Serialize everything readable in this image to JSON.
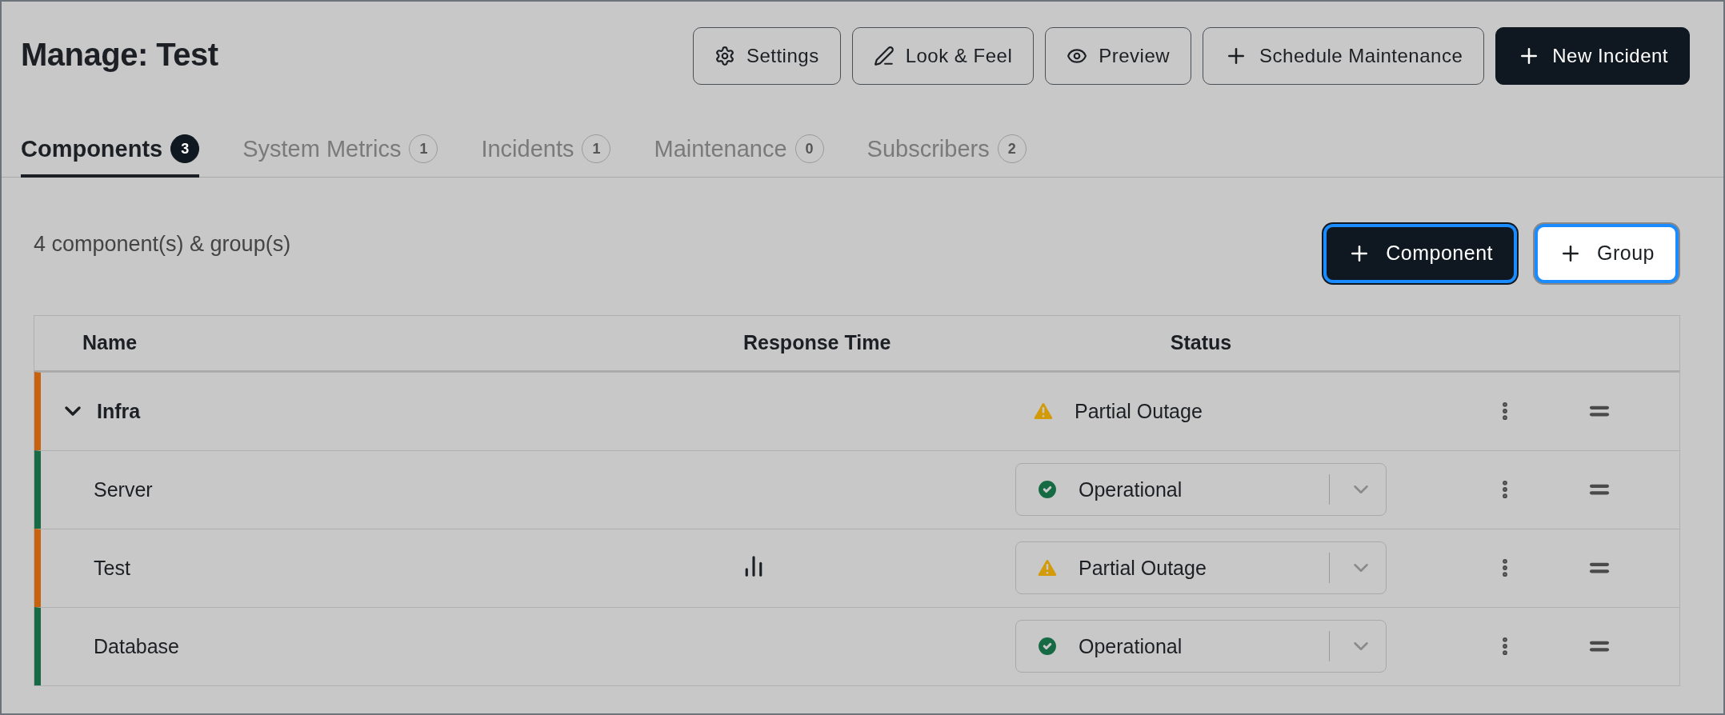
{
  "title": "Manage: Test",
  "header_buttons": [
    {
      "label": "Settings",
      "kind": "settings",
      "primary": false
    },
    {
      "label": "Look & Feel",
      "kind": "style",
      "primary": false
    },
    {
      "label": "Preview",
      "kind": "preview",
      "primary": false
    },
    {
      "label": "Schedule Maintenance",
      "kind": "add",
      "primary": false
    },
    {
      "label": "New Incident",
      "kind": "add",
      "primary": true
    }
  ],
  "tabs": [
    {
      "label": "Components",
      "count": "3",
      "selected": true
    },
    {
      "label": "System Metrics",
      "count": "1",
      "selected": false
    },
    {
      "label": "Incidents",
      "count": "1",
      "selected": false
    },
    {
      "label": "Maintenance",
      "count": "0",
      "selected": false
    },
    {
      "label": "Subscribers",
      "count": "2",
      "selected": false
    }
  ],
  "summary": "4 component(s) & group(s)",
  "add_buttons": [
    {
      "label": "Component",
      "primary": true,
      "focused": true
    },
    {
      "label": "Group",
      "primary": false,
      "focused": true
    }
  ],
  "table": {
    "columns": [
      "Name",
      "Response Time",
      "Status"
    ],
    "rows": [
      {
        "kind": "group",
        "name": "Infra",
        "color": "#c8620e",
        "expanded": true,
        "status": {
          "label": "Partial Outage",
          "kind": "partial"
        },
        "children": [
          {
            "kind": "component",
            "name": "Server",
            "color": "#166b44",
            "response_chart": false,
            "status": {
              "label": "Operational",
              "kind": "ok"
            }
          },
          {
            "kind": "component",
            "name": "Test",
            "color": "#c8620e",
            "response_chart": true,
            "status": {
              "label": "Partial Outage",
              "kind": "partial"
            }
          },
          {
            "kind": "component",
            "name": "Database",
            "color": "#166b44",
            "response_chart": false,
            "status": {
              "label": "Operational",
              "kind": "ok"
            }
          }
        ]
      }
    ]
  }
}
